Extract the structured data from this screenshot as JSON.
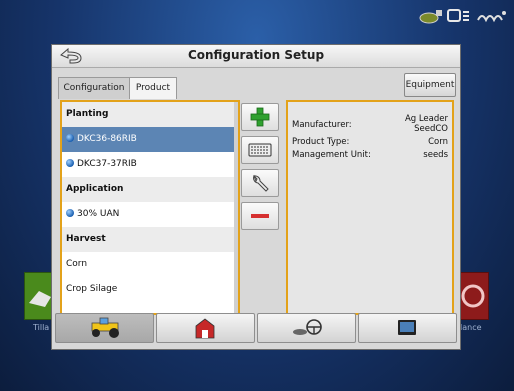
{
  "background": {
    "left_app_label": "Tilla",
    "right_app_label": "lance",
    "topbar_icons": [
      "gps-satellite-icon",
      "display-status-icon",
      "signal-icon"
    ]
  },
  "dialog": {
    "title": "Configuration Setup",
    "back_icon": "back-arrow-icon",
    "tabs": [
      {
        "label": "Configuration",
        "active": false
      },
      {
        "label": "Product",
        "active": true
      }
    ],
    "equipment_button": "Equipment",
    "product_list": {
      "rows": [
        {
          "type": "header",
          "label": "Planting"
        },
        {
          "type": "item",
          "label": "DKC36-86RIB",
          "selected": true
        },
        {
          "type": "item",
          "label": "DKC37-37RIB",
          "selected": false
        },
        {
          "type": "header",
          "label": "Application"
        },
        {
          "type": "item",
          "label": "30% UAN",
          "selected": false
        },
        {
          "type": "header",
          "label": "Harvest"
        },
        {
          "type": "plain",
          "label": "Corn",
          "selected": false
        },
        {
          "type": "plain",
          "label": "Crop Silage",
          "selected": false
        }
      ]
    },
    "tools": [
      {
        "name": "add-button",
        "icon": "plus-icon"
      },
      {
        "name": "keyboard-button",
        "icon": "keyboard-icon"
      },
      {
        "name": "edit-button",
        "icon": "wrench-icon"
      },
      {
        "name": "remove-button",
        "icon": "minus-icon"
      }
    ],
    "details": {
      "manufacturer_label": "Manufacturer:",
      "manufacturer_value_line1": "Ag Leader",
      "manufacturer_value_line2": "SeedCO",
      "product_type_label": "Product Type:",
      "product_type_value": "Corn",
      "management_unit_label": "Management Unit:",
      "management_unit_value": "seeds"
    }
  },
  "bottom_nav": [
    {
      "name": "vehicle-button",
      "icon": "tractor-icon",
      "active": true
    },
    {
      "name": "farm-button",
      "icon": "barn-icon",
      "active": false
    },
    {
      "name": "steering-button",
      "icon": "steering-wheel-icon",
      "active": false
    },
    {
      "name": "display-button",
      "icon": "monitor-icon",
      "active": false
    }
  ],
  "colors": {
    "selection": "#5c85b4",
    "highlight_border": "#e3a21a",
    "add_green": "#2fa12f",
    "remove_red": "#d63030"
  }
}
